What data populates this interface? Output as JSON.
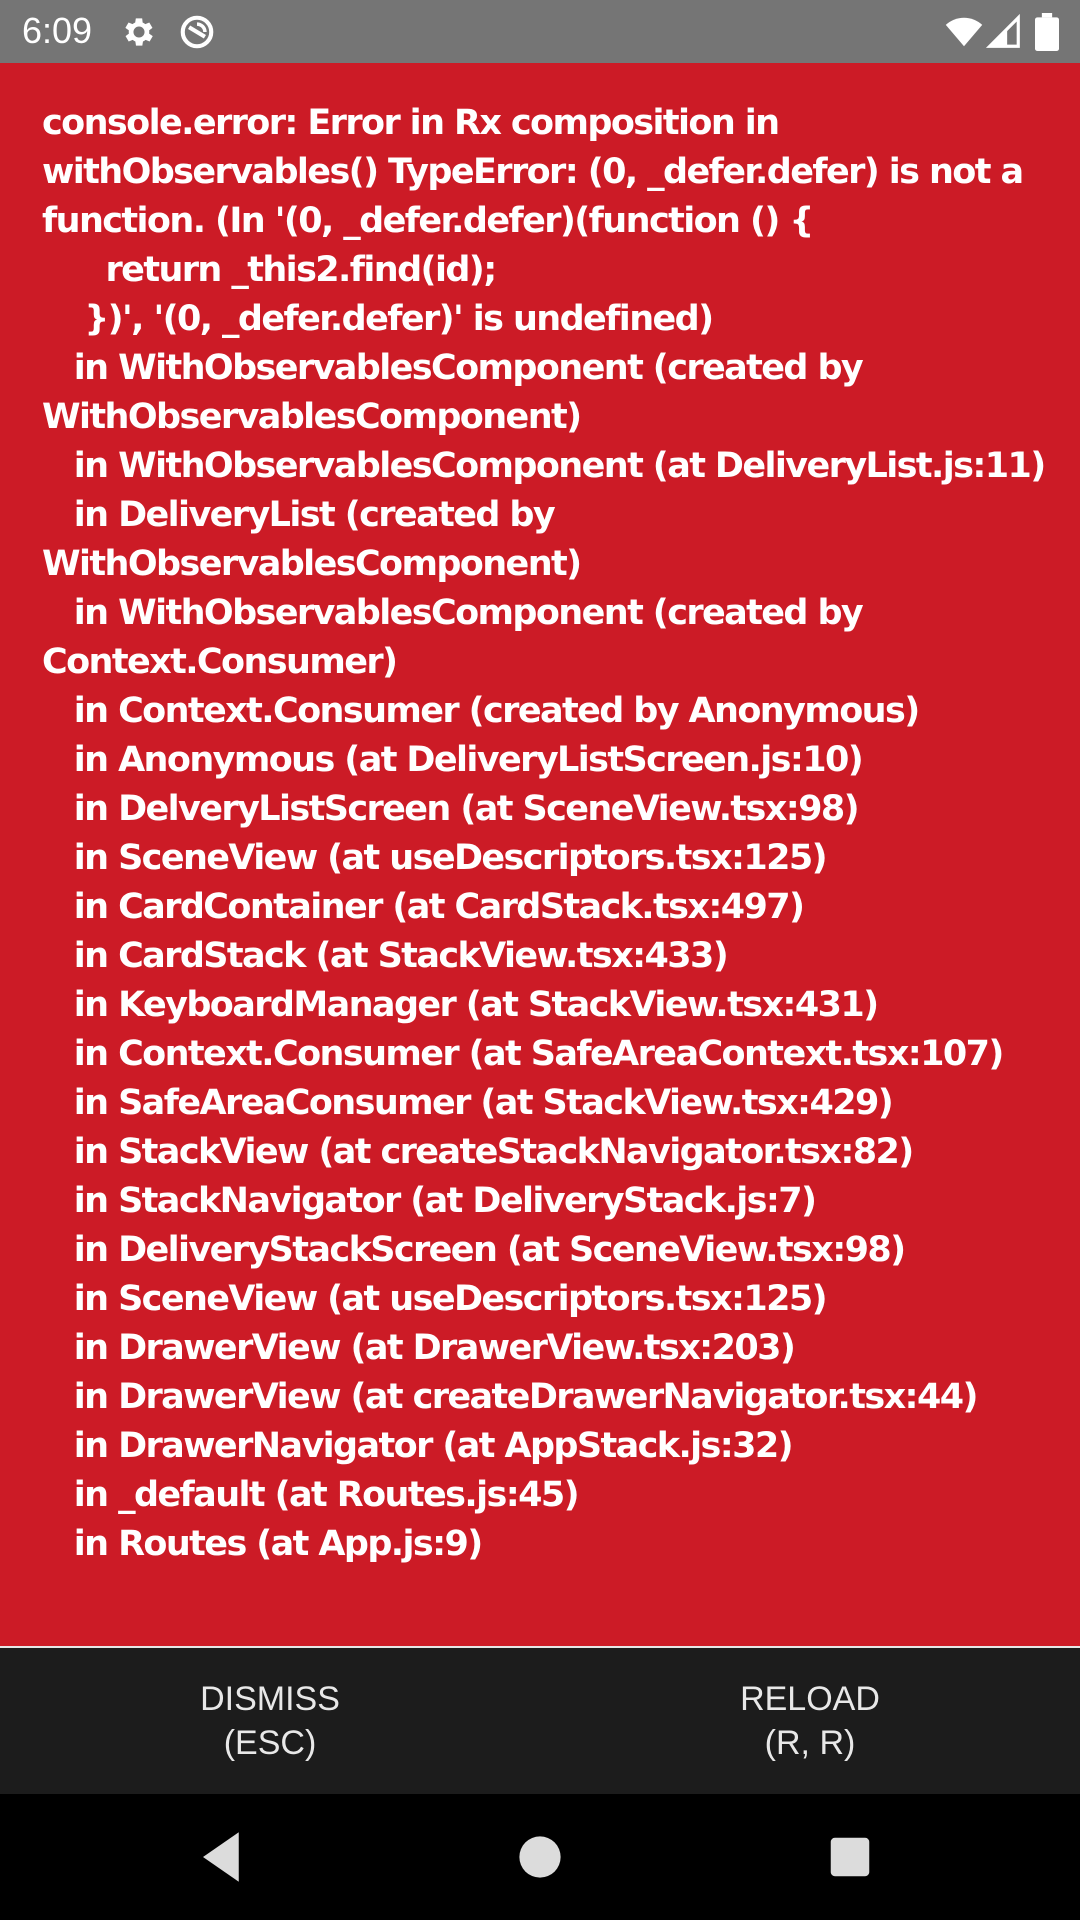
{
  "status_bar": {
    "time": "6:09",
    "icons": [
      "gear-icon",
      "do-not-disturb-icon",
      "wifi-icon",
      "cell-signal-icon",
      "battery-icon"
    ]
  },
  "error": {
    "message": "console.error: Error in Rx composition in withObservables() TypeError: (0, _defer.defer) is not a function. (In '(0, _defer.defer)(function () {\n      return _this2.find(id);\n    })', '(0, _defer.defer)' is undefined)\n   in WithObservablesComponent (created by WithObservablesComponent)\n   in WithObservablesComponent (at DeliveryList.js:11)\n   in DeliveryList (created by WithObservablesComponent)\n   in WithObservablesComponent (created by Context.Consumer)\n   in Context.Consumer (created by Anonymous)\n   in Anonymous (at DeliveryListScreen.js:10)\n   in DelveryListScreen (at SceneView.tsx:98)\n   in SceneView (at useDescriptors.tsx:125)\n   in CardContainer (at CardStack.tsx:497)\n   in CardStack (at StackView.tsx:433)\n   in KeyboardManager (at StackView.tsx:431)\n   in Context.Consumer (at SafeAreaContext.tsx:107)\n   in SafeAreaConsumer (at StackView.tsx:429)\n   in StackView (at createStackNavigator.tsx:82)\n   in StackNavigator (at DeliveryStack.js:7)\n   in DeliveryStackScreen (at SceneView.tsx:98)\n   in SceneView (at useDescriptors.tsx:125)\n   in DrawerView (at DrawerView.tsx:203)\n   in DrawerView (at createDrawerNavigator.tsx:44)\n   in DrawerNavigator (at AppStack.js:32)\n   in _default (at Routes.js:45)\n   in Routes (at App.js:9)"
  },
  "buttons": {
    "dismiss": {
      "label": "DISMISS",
      "shortcut": "(ESC)"
    },
    "reload": {
      "label": "RELOAD",
      "shortcut": "(R, R)"
    }
  },
  "nav": {
    "icons": [
      "back-icon",
      "home-icon",
      "recents-icon"
    ]
  },
  "colors": {
    "error_background": "#cc1b26",
    "status_bar": "#757575",
    "button_bar": "#1c1c1c"
  }
}
